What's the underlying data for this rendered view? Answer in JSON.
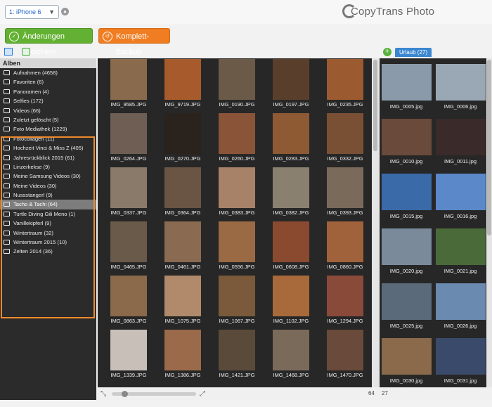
{
  "device": {
    "selected": "1: iPhone 6"
  },
  "app": {
    "logo_text": "CopyTrans Photo"
  },
  "actions": {
    "save_label": "Änderungen speichern",
    "backup_label": "Komplett-Backup"
  },
  "sidebar": {
    "header": "Alben",
    "items": [
      {
        "label": "Aufnahmen (4658)",
        "icon": "camera-icon"
      },
      {
        "label": "Favoriten (6)",
        "icon": "heart-icon"
      },
      {
        "label": "Panoramen (4)",
        "icon": "panorama-icon"
      },
      {
        "label": "Selfies (172)",
        "icon": "selfie-icon"
      },
      {
        "label": "Videos (66)",
        "icon": "video-icon"
      },
      {
        "label": "Zuletzt gelöscht (5)",
        "icon": "trash-icon"
      },
      {
        "label": "Foto Mediathek (1229)",
        "icon": "camera-icon"
      },
      {
        "label": "Fotocollagen (11)",
        "icon": "album-icon"
      },
      {
        "label": "Hochzeit Vinci & Miss Z (405)",
        "icon": "album-icon"
      },
      {
        "label": "Jahresrückblick 2015 (61)",
        "icon": "album-icon"
      },
      {
        "label": "Linzerkekse (9)",
        "icon": "album-icon"
      },
      {
        "label": "Meine Samsung Videos (30)",
        "icon": "album-icon"
      },
      {
        "label": "Meine Videos (30)",
        "icon": "album-icon"
      },
      {
        "label": "Nussstangerl (9)",
        "icon": "album-icon"
      },
      {
        "label": "Tacho & Tachi (64)",
        "icon": "album-icon",
        "selected": true
      },
      {
        "label": "Turtle Diving Gili Meno (1)",
        "icon": "album-icon"
      },
      {
        "label": "Vanillekipferl (9)",
        "icon": "album-icon"
      },
      {
        "label": "Wintertraum (32)",
        "icon": "album-icon"
      },
      {
        "label": "Wintertraum 2015 (10)",
        "icon": "album-icon"
      },
      {
        "label": "Zelten 2014 (36)",
        "icon": "album-icon"
      }
    ]
  },
  "grid": {
    "photos": [
      {
        "name": "IMG_9585.JPG",
        "color": "#8a6a4c"
      },
      {
        "name": "IMG_9719.JPG",
        "color": "#a75a2c"
      },
      {
        "name": "IMG_0190.JPG",
        "color": "#6b5a48"
      },
      {
        "name": "IMG_0197.JPG",
        "color": "#5a3e2c"
      },
      {
        "name": "IMG_0235.JPG",
        "color": "#9b5a30"
      },
      {
        "name": "IMG_0264.JPG",
        "color": "#6e5e54"
      },
      {
        "name": "IMG_0270.JPG",
        "color": "#2a221c"
      },
      {
        "name": "IMG_0260.JPG",
        "color": "#8a5438"
      },
      {
        "name": "IMG_0283.JPG",
        "color": "#8d5a34"
      },
      {
        "name": "IMG_0332.JPG",
        "color": "#7a5034"
      },
      {
        "name": "IMG_0337.JPG",
        "color": "#8a7a6a"
      },
      {
        "name": "IMG_0364.JPG",
        "color": "#6a5444"
      },
      {
        "name": "IMG_0383.JPG",
        "color": "#a88268"
      },
      {
        "name": "IMG_0382.JPG",
        "color": "#8a8070"
      },
      {
        "name": "IMG_0393.JPG",
        "color": "#7a6a5a"
      },
      {
        "name": "IMG_0465.JPG",
        "color": "#6a5a4a"
      },
      {
        "name": "IMG_0461.JPG",
        "color": "#8a6a50"
      },
      {
        "name": "IMG_0556.JPG",
        "color": "#9a6a44"
      },
      {
        "name": "IMG_0608.JPG",
        "color": "#8a4a30"
      },
      {
        "name": "IMG_0860.JPG",
        "color": "#a0623a"
      },
      {
        "name": "IMG_0863.JPG",
        "color": "#8a6a4a"
      },
      {
        "name": "IMG_1075.JPG",
        "color": "#b08a6a"
      },
      {
        "name": "IMG_1067.JPG",
        "color": "#7a5a3a"
      },
      {
        "name": "IMG_1102.JPG",
        "color": "#a86a3a"
      },
      {
        "name": "IMG_1294.JPG",
        "color": "#8a4a3a"
      },
      {
        "name": "IMG_1339.JPG",
        "color": "#c8c0b8"
      },
      {
        "name": "IMG_1386.JPG",
        "color": "#9a6a4a"
      },
      {
        "name": "IMG_1421.JPG",
        "color": "#5a4a3a"
      },
      {
        "name": "IMG_1468.JPG",
        "color": "#7a6a5a"
      },
      {
        "name": "IMG_1470.JPG",
        "color": "#6a4a3a"
      }
    ],
    "count": "64"
  },
  "album_panel": {
    "tab_label": "Urlaub (27)",
    "photos": [
      {
        "name": "IMG_0005.jpg",
        "color": "#8a9aaa"
      },
      {
        "name": "IMG_0006.jpg",
        "color": "#9aa8b6"
      },
      {
        "name": "IMG_0010.jpg",
        "color": "#6a4a3a"
      },
      {
        "name": "IMG_0011.jpg",
        "color": "#3a2a2a"
      },
      {
        "name": "IMG_0015.jpg",
        "color": "#3a6aa8"
      },
      {
        "name": "IMG_0016.jpg",
        "color": "#5a88c8"
      },
      {
        "name": "IMG_0020.jpg",
        "color": "#7a8a9a"
      },
      {
        "name": "IMG_0021.jpg",
        "color": "#4a6a3a"
      },
      {
        "name": "IMG_0025.jpg",
        "color": "#5a6a7a"
      },
      {
        "name": "IMG_0026.jpg",
        "color": "#6a8ab0"
      },
      {
        "name": "IMG_0030.jpg",
        "color": "#8a6a4a"
      },
      {
        "name": "IMG_0031.jpg",
        "color": "#3a4a6a"
      }
    ],
    "count": "27"
  }
}
